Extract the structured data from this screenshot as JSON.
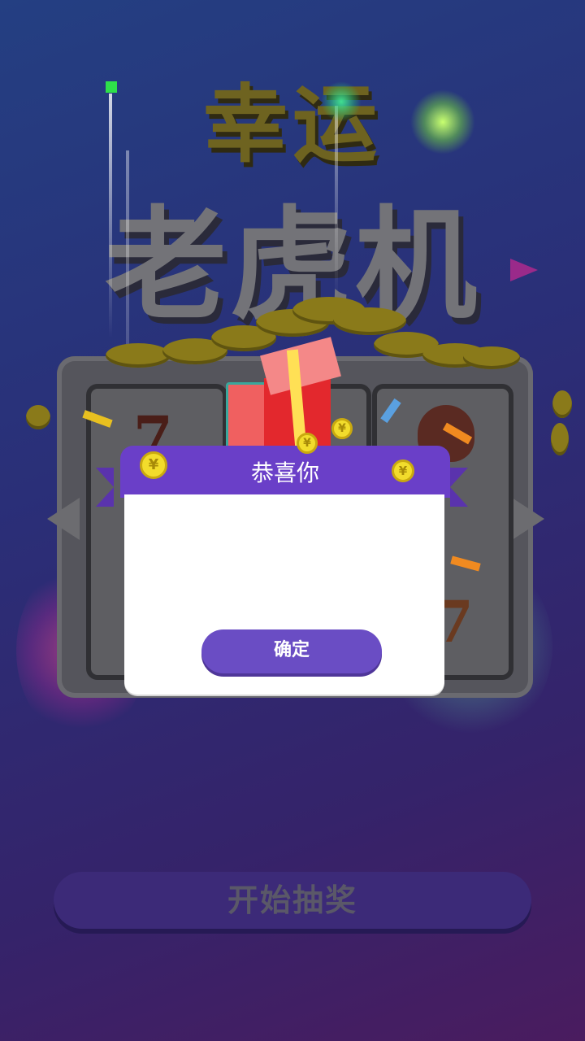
{
  "title": {
    "line1": "幸运",
    "line2": "老虎机"
  },
  "dialog": {
    "title": "恭喜你",
    "confirm_label": "确定",
    "coin_symbol": "¥"
  },
  "start_button": {
    "label": "开始抽奖"
  },
  "reels": [
    {
      "symbol": "7"
    },
    {
      "symbol": "7"
    }
  ],
  "colors": {
    "background_top": "#243f82",
    "background_bottom": "#4a1c5f",
    "dialog_header": "#6a3fc8",
    "confirm_button": "#6a4dc4",
    "coin": "#f2dc2c"
  }
}
